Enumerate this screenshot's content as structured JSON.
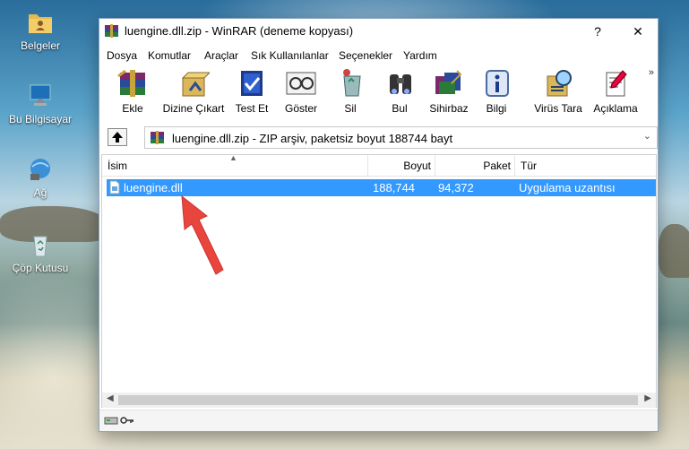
{
  "desktop": {
    "icons": [
      {
        "label": "Belgeler",
        "icon": "folder-user-icon"
      },
      {
        "label": "Bu Bilgisayar",
        "icon": "computer-icon"
      },
      {
        "label": "Ağ",
        "icon": "network-icon"
      },
      {
        "label": "Çöp Kutusu",
        "icon": "recycle-bin-icon"
      }
    ]
  },
  "window": {
    "title": "luengine.dll.zip - WinRAR (deneme kopyası)",
    "help": "?",
    "close": "✕"
  },
  "menu": [
    "Dosya",
    "Komutlar",
    "Araçlar",
    "Sık Kullanılanlar",
    "Seçenekler",
    "Yardım"
  ],
  "toolbar": {
    "buttons": [
      {
        "label": "Ekle",
        "icon": "add-archive-icon"
      },
      {
        "label": "Dizine Çıkart",
        "icon": "extract-icon"
      },
      {
        "label": "Test Et",
        "icon": "test-icon"
      },
      {
        "label": "Göster",
        "icon": "view-icon"
      },
      {
        "label": "Sil",
        "icon": "delete-icon"
      },
      {
        "label": "Bul",
        "icon": "find-icon"
      },
      {
        "label": "Sihirbaz",
        "icon": "wizard-icon"
      },
      {
        "label": "Bilgi",
        "icon": "info-icon"
      },
      {
        "label": "Virüs Tara",
        "icon": "virus-scan-icon"
      },
      {
        "label": "Açıklama",
        "icon": "comment-icon"
      }
    ],
    "more": "»"
  },
  "path": {
    "text": "luengine.dll.zip - ZIP arşiv, paketsiz boyut 188744 bayt"
  },
  "columns": {
    "name": "İsim",
    "size": "Boyut",
    "packed": "Paket",
    "type": "Tür"
  },
  "files": [
    {
      "name": "luengine.dll",
      "size": "188,744",
      "packed": "94,372",
      "type": "Uygulama uzantısı",
      "selected": true
    }
  ],
  "colors": {
    "selection": "#3399ff",
    "arrow": "#e8453c"
  }
}
